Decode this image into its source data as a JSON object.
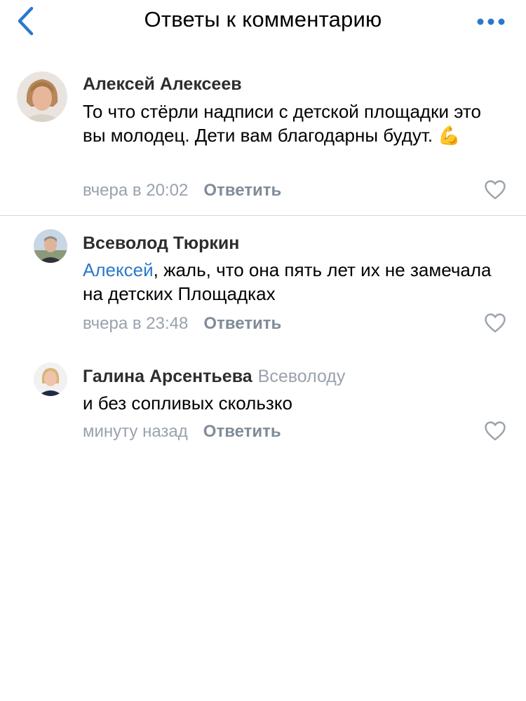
{
  "nav": {
    "title": "Ответы к комментарию"
  },
  "colors": {
    "accent": "#2a78cc",
    "secondary_text": "#99a2ad",
    "reply_button": "#818c99"
  },
  "comments": [
    {
      "author": "Алексей Алексеев",
      "reply_to": "",
      "mention": "",
      "text": "То что стёрли надписи с детской площадки это вы молодец. Дети вам благодарны будут. 💪",
      "time": "вчера в 20:02",
      "reply_label": "Ответить",
      "avatar_icon": "user-avatar",
      "like_icon": "heart-icon"
    },
    {
      "author": "Всеволод Тюркин",
      "reply_to": "",
      "mention": "Алексей",
      "text": ", жаль, что она пять лет их не замечала на детских Площадках",
      "time": "вчера в 23:48",
      "reply_label": "Ответить",
      "avatar_icon": "user-avatar",
      "like_icon": "heart-icon"
    },
    {
      "author": "Галина Арсентьева",
      "reply_to": "Всеволоду",
      "mention": "",
      "text": "и без сопливых скользко",
      "time": "минуту назад",
      "reply_label": "Ответить",
      "avatar_icon": "user-avatar",
      "like_icon": "heart-icon"
    }
  ]
}
